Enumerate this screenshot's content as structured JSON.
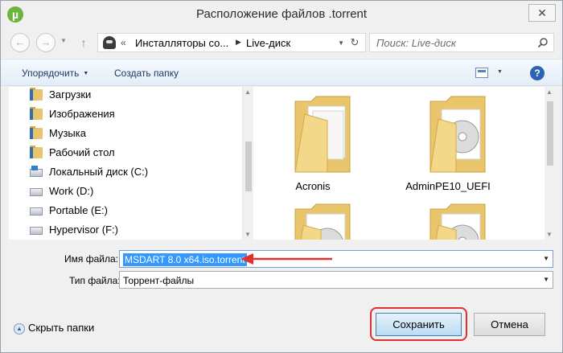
{
  "window": {
    "title": "Расположение файлов .torrent",
    "app_icon_glyph": "µ",
    "close_glyph": "✕"
  },
  "address": {
    "back_glyph": "←",
    "forward_glyph": "→",
    "path_prefix": "«",
    "path_segments": [
      "Инсталляторы со...",
      "Live-диск"
    ],
    "search_placeholder": "Поиск: Live-диск"
  },
  "toolbar": {
    "organize_label": "Упорядочить",
    "new_folder_label": "Создать папку",
    "help_glyph": "?"
  },
  "nav_pane": {
    "items": [
      {
        "label": "Загрузки",
        "icon": "folder-icon"
      },
      {
        "label": "Изображения",
        "icon": "folder-icon"
      },
      {
        "label": "Музыка",
        "icon": "folder-icon"
      },
      {
        "label": "Рабочий стол",
        "icon": "folder-icon"
      },
      {
        "label": "Локальный диск (C:)",
        "icon": "system-drive-icon"
      },
      {
        "label": "Work (D:)",
        "icon": "drive-icon"
      },
      {
        "label": "Portable (E:)",
        "icon": "drive-icon"
      },
      {
        "label": "Hypervisor (F:)",
        "icon": "drive-icon"
      }
    ]
  },
  "content_pane": {
    "items": [
      {
        "label": "Acronis",
        "icon": "folder-with-discs-icon"
      },
      {
        "label": "AdminPE10_UEFI",
        "icon": "folder-with-discs-icon"
      },
      {
        "label": "",
        "icon": "folder-with-discs-icon"
      },
      {
        "label": "",
        "icon": "folder-with-discs-icon"
      }
    ]
  },
  "form": {
    "filename_label": "Имя файла:",
    "filename_value": "MSDART 8.0 x64.iso.torrent",
    "filetype_label": "Тип файла:",
    "filetype_value": "Торрент-файлы"
  },
  "footer": {
    "hide_folders_label": "Скрыть папки",
    "save_label": "Сохранить",
    "cancel_label": "Отмена"
  },
  "colors": {
    "accent_red": "#e03131",
    "selection_blue": "#3399ff",
    "folder_yellow": "#e8c46a"
  }
}
